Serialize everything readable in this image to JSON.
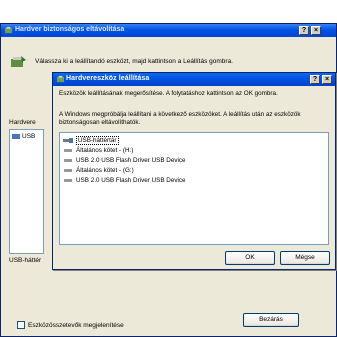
{
  "outer": {
    "title": "Hardver biztonságos eltávolítása",
    "help_button": "?",
    "close_button": "×",
    "instruction": "Válassza ki a leállítandó eszközt, majd kattintson a Leállítás gombra.",
    "hardware_label": "Hardvere",
    "device_list_item": "USB",
    "usb_label": "USB-háttér",
    "show_components_label": "Eszközösszetevők megjelenítése",
    "close_label": "Bezárás"
  },
  "dialog": {
    "title": "Hardvereszköz leállítása",
    "help_button": "?",
    "close_button": "×",
    "text1": "Eszközök leállításának megerősítése. A folytatáshoz kattintson az OK gombra.",
    "text2": "A Windows megpróbálja leállítani a következő eszközöket. A leállítás után az eszközök biztonságosan eltávolíthatók.",
    "devices": [
      {
        "label": "USB-háttértár",
        "icon": "usb-storage-icon"
      },
      {
        "label": "Általános kötet - (H:)",
        "icon": "drive-icon"
      },
      {
        "label": "USB 2.0 USB Flash Driver USB Device",
        "icon": "drive-icon"
      },
      {
        "label": "Általános kötet - (G:)",
        "icon": "drive-icon"
      },
      {
        "label": "USB 2.0 USB Flash Driver USB Device",
        "icon": "drive-icon"
      }
    ],
    "ok_label": "OK",
    "cancel_label": "Mégse"
  }
}
